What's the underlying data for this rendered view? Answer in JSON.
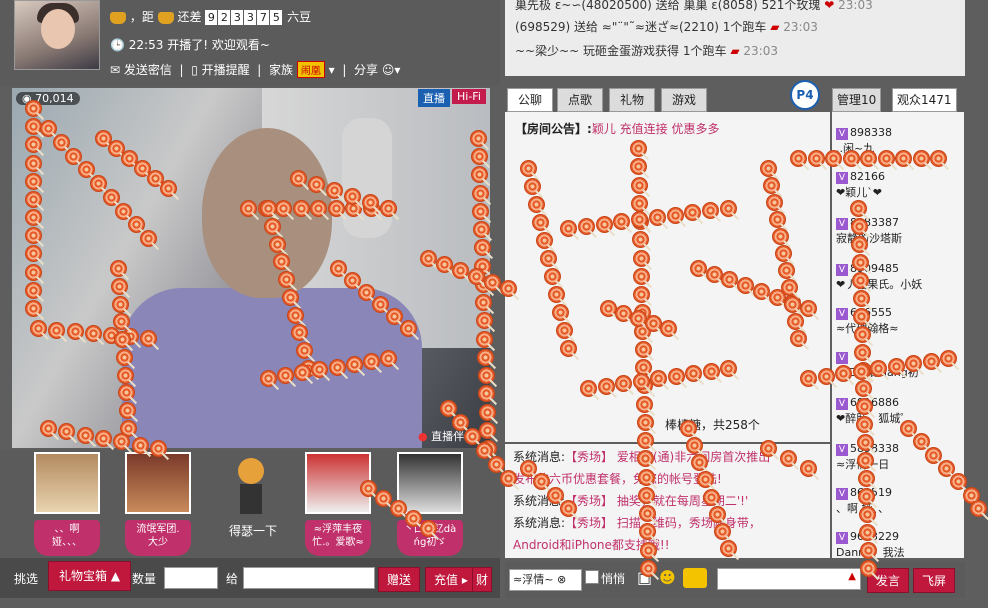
{
  "header": {
    "distance_prefix": "，距",
    "remaining_label": "还差",
    "remaining_digits": [
      "9",
      "2",
      "3",
      "3",
      "7",
      "5"
    ],
    "target_level": "六豆",
    "start_time": "22:53",
    "start_text": "开播了! 欢迎观看~",
    "send_msg": "发送密信",
    "start_remind": "开播提醒",
    "family_label": "家族",
    "family_tag": "闹凰",
    "share_label": "分享"
  },
  "video": {
    "view_count": "70,014",
    "live_label": "直播",
    "hifi_label": "Hi-Fi",
    "partner_label": "直播伴侣"
  },
  "gifts": [
    {
      "label": "、、啊\n娅、、、"
    },
    {
      "label": "流氓军团.\n大少"
    },
    {
      "label": "得瑟一下"
    },
    {
      "label": "≈浮萍丰夜\n忙.。爱歌≈"
    },
    {
      "label": "丶口迥钇dà\nńg初ゞ"
    }
  ],
  "toolbar": {
    "pick_label": "挑选",
    "gift_box": "礼物宝箱",
    "qty_label": "数量",
    "give_label": "给",
    "send_gift": "赠送",
    "recharge": "充值",
    "wealth": "财"
  },
  "chatlog": [
    "巢先极 ε~∽(48020500) 送给 巢巢 ε(8058) 521个玫瑰",
    "(698529) 送给 ≈\"¨\"˜≈迷ざ≈(2210) 1个跑车",
    "~~梁少~~ 玩砸金蛋游戏获得 1个跑车"
  ],
  "chatlog_times": [
    "23:03",
    "23:03",
    "23:03"
  ],
  "tabs": [
    "公聊",
    "点歌",
    "礼物",
    "游戏"
  ],
  "p4_badge": "P4",
  "announcement": {
    "prefix": "【房间公告】:",
    "text": "颖儿 充值连接 优惠多多"
  },
  "gift_summary": "棒棒糖，共258个",
  "system_messages": [
    {
      "prefix": "系统消息:",
      "text": "【秀场】 爱相随(通)非六间房首次推出"
    },
    {
      "prefix": "",
      "text": "发布的六币优惠套餐，免您的帐号登陆!"
    },
    {
      "prefix": "系统消息:",
      "text": "【秀场】 抽奖，就在每周星期二'!'"
    },
    {
      "prefix": "系统消息:",
      "text": "【秀场】 扫描二维码，秀场随身带，"
    },
    {
      "prefix": "",
      "text": "Android和iPhone都支持哦!!"
    }
  ],
  "user_tabs": {
    "admin": "管理10",
    "audience": "观众1471"
  },
  "users": [
    {
      "id": "898338",
      "nick": "..闲~九"
    },
    {
      "id": "82166",
      "nick": "❤颖儿`❤"
    },
    {
      "id": "8983387",
      "nick": "寂静的沙塔斯"
    },
    {
      "id": "8909485",
      "nick": "❤丿糖果氏。小妖"
    },
    {
      "id": "666555",
      "nick": "≈代理翰格≈"
    },
    {
      "id": "",
      "nick": "丶口迥钇dàng初"
    },
    {
      "id": "6916886",
      "nick": "❤醉卧、狐城゜"
    },
    {
      "id": "5898338",
      "nick": "≈浮情一日"
    },
    {
      "id": "861519",
      "nick": "、啊 娅、、"
    },
    {
      "id": "9633229",
      "nick": "Danny、我法"
    }
  ],
  "chatbar": {
    "whisper_target": "≈浮情~",
    "whisper_label": "悄悄",
    "send_label": "发言",
    "fly_label": "飞屏"
  }
}
